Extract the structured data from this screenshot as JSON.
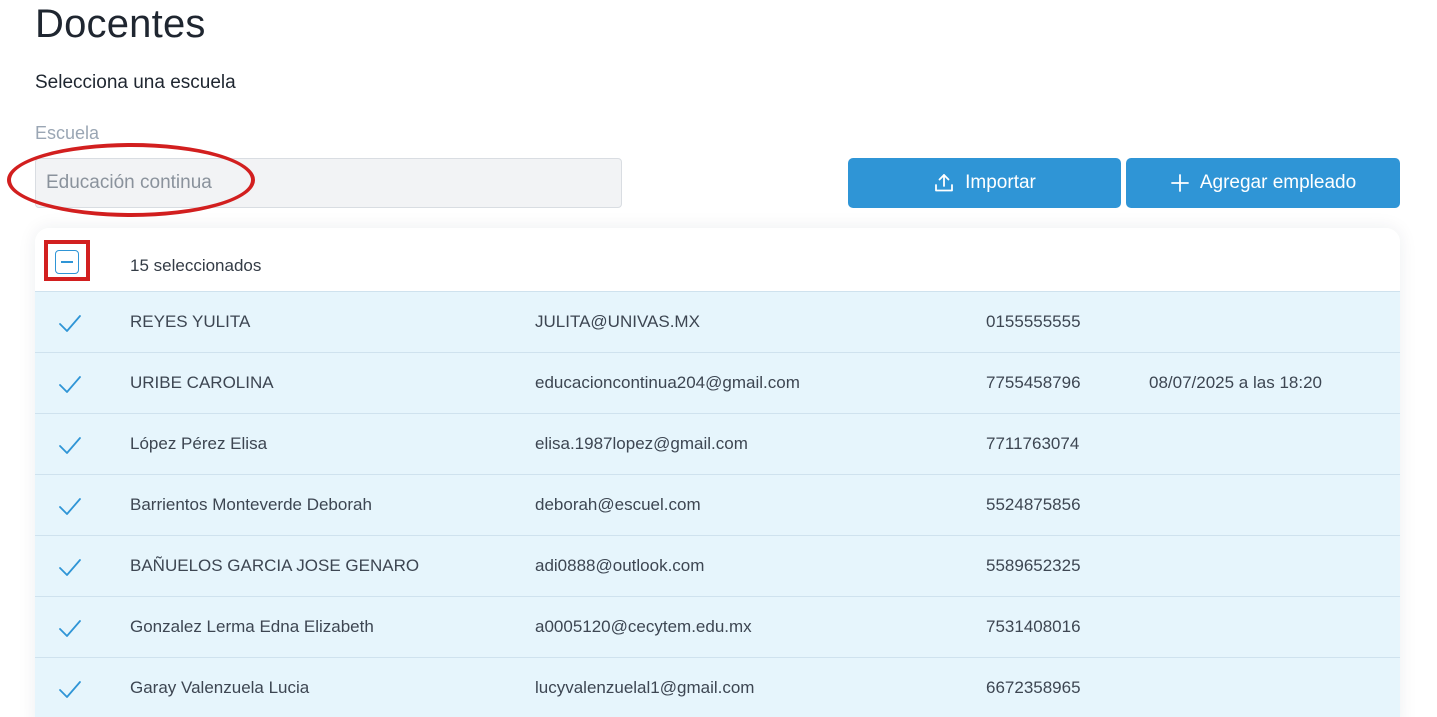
{
  "page": {
    "title": "Docentes",
    "subtitle": "Selecciona una escuela"
  },
  "school": {
    "label": "Escuela",
    "value": "Educación continua"
  },
  "actions": {
    "import_label": "Importar",
    "add_label": "Agregar empleado"
  },
  "table": {
    "selected_count_text": "15 seleccionados",
    "rows": [
      {
        "name": "REYES YULITA",
        "email": "JULITA@UNIVAS.MX",
        "phone": "0155555555",
        "date": ""
      },
      {
        "name": "URIBE CAROLINA",
        "email": "educacioncontinua204@gmail.com",
        "phone": "7755458796",
        "date": "08/07/2025 a las 18:20"
      },
      {
        "name": "López Pérez Elisa",
        "email": "elisa.1987lopez@gmail.com",
        "phone": "7711763074",
        "date": ""
      },
      {
        "name": "Barrientos Monteverde Deborah",
        "email": "deborah@escuel.com",
        "phone": "5524875856",
        "date": ""
      },
      {
        "name": "BAÑUELOS  GARCIA JOSE GENARO",
        "email": "adi0888@outlook.com",
        "phone": "5589652325",
        "date": ""
      },
      {
        "name": "Gonzalez  Lerma Edna Elizabeth",
        "email": "a0005120@cecytem.edu.mx",
        "phone": "7531408016",
        "date": ""
      },
      {
        "name": "Garay  Valenzuela Lucia",
        "email": "lucyvalenzuelal1@gmail.com",
        "phone": "6672358965",
        "date": ""
      }
    ]
  },
  "colors": {
    "accent": "#2f95d6",
    "row_selected_bg": "#e6f5fc",
    "annotation_red": "#d21f1f"
  },
  "icons": {
    "import": "upload-icon",
    "add": "plus-icon",
    "row_check": "check-icon",
    "select_all": "indeterminate-checkbox-icon"
  }
}
